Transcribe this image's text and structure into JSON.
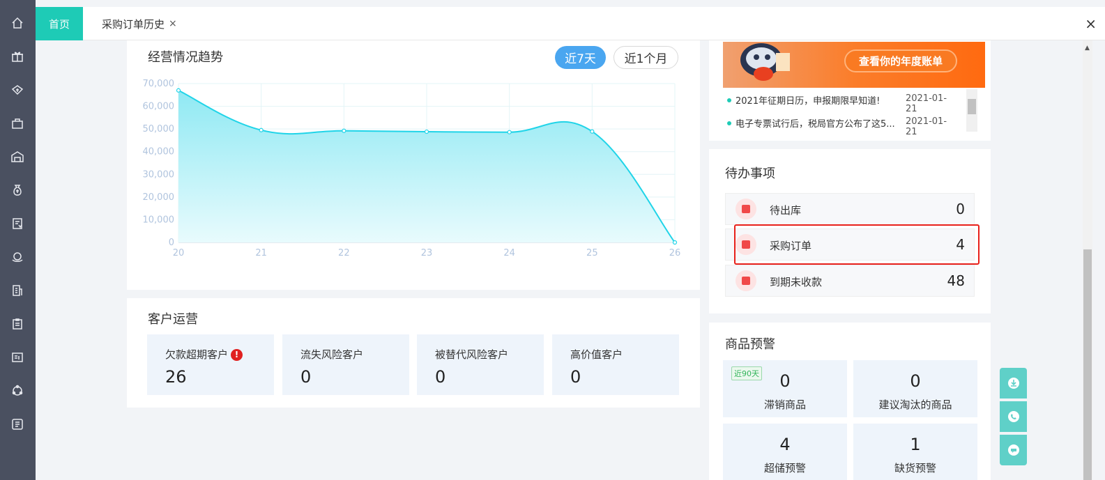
{
  "tabs": {
    "home": "首页",
    "purchase_history": "采购订单历史",
    "close_symbol": "×"
  },
  "trend": {
    "title": "经营情况趋势",
    "range_7": "近7天",
    "range_30": "近1个月"
  },
  "chart_data": {
    "type": "area",
    "title": "经营情况趋势",
    "categories": [
      "20",
      "21",
      "22",
      "23",
      "24",
      "25",
      "26"
    ],
    "values": [
      67000,
      49500,
      49200,
      48800,
      48600,
      48900,
      0
    ],
    "ylim": [
      0,
      70000
    ],
    "yticks": [
      "0",
      "10,000",
      "20,000",
      "30,000",
      "40,000",
      "50,000",
      "60,000",
      "70,000"
    ],
    "grid": true,
    "colors": {
      "line": "#20d4e8",
      "fill_top": "#8fe9f3",
      "fill_bottom": "#e8fbfd",
      "axis": "#b0c4de"
    }
  },
  "customer_ops": {
    "title": "客户运营",
    "items": [
      {
        "label": "欠款超期客户",
        "value": "26",
        "warn": "!"
      },
      {
        "label": "流失风险客户",
        "value": "0"
      },
      {
        "label": "被替代风险客户",
        "value": "0"
      },
      {
        "label": "高价值客户",
        "value": "0"
      }
    ]
  },
  "banner": {
    "button": "查看你的年度账单"
  },
  "news": [
    {
      "text": "2021年征期日历，申报期限早知道!",
      "date": "2021-01-21"
    },
    {
      "text": "电子专票试行后，税局官方公布了这5...",
      "date": "2021-01-21"
    }
  ],
  "todo": {
    "title": "待办事项",
    "items": [
      {
        "label": "待出库",
        "value": "0"
      },
      {
        "label": "采购订单",
        "value": "4"
      },
      {
        "label": "到期未收款",
        "value": "48"
      }
    ]
  },
  "product_alerts": {
    "title": "商品预警",
    "tag": "近90天",
    "items": [
      {
        "label": "滞销商品",
        "value": "0"
      },
      {
        "label": "建议淘汰的商品",
        "value": "0"
      },
      {
        "label": "超储预警",
        "value": "4"
      },
      {
        "label": "缺货预警",
        "value": "1"
      }
    ]
  },
  "colors": {
    "accent": "#1ecbb6",
    "sidebar": "#4a5060",
    "highlight": "#e8201a"
  }
}
